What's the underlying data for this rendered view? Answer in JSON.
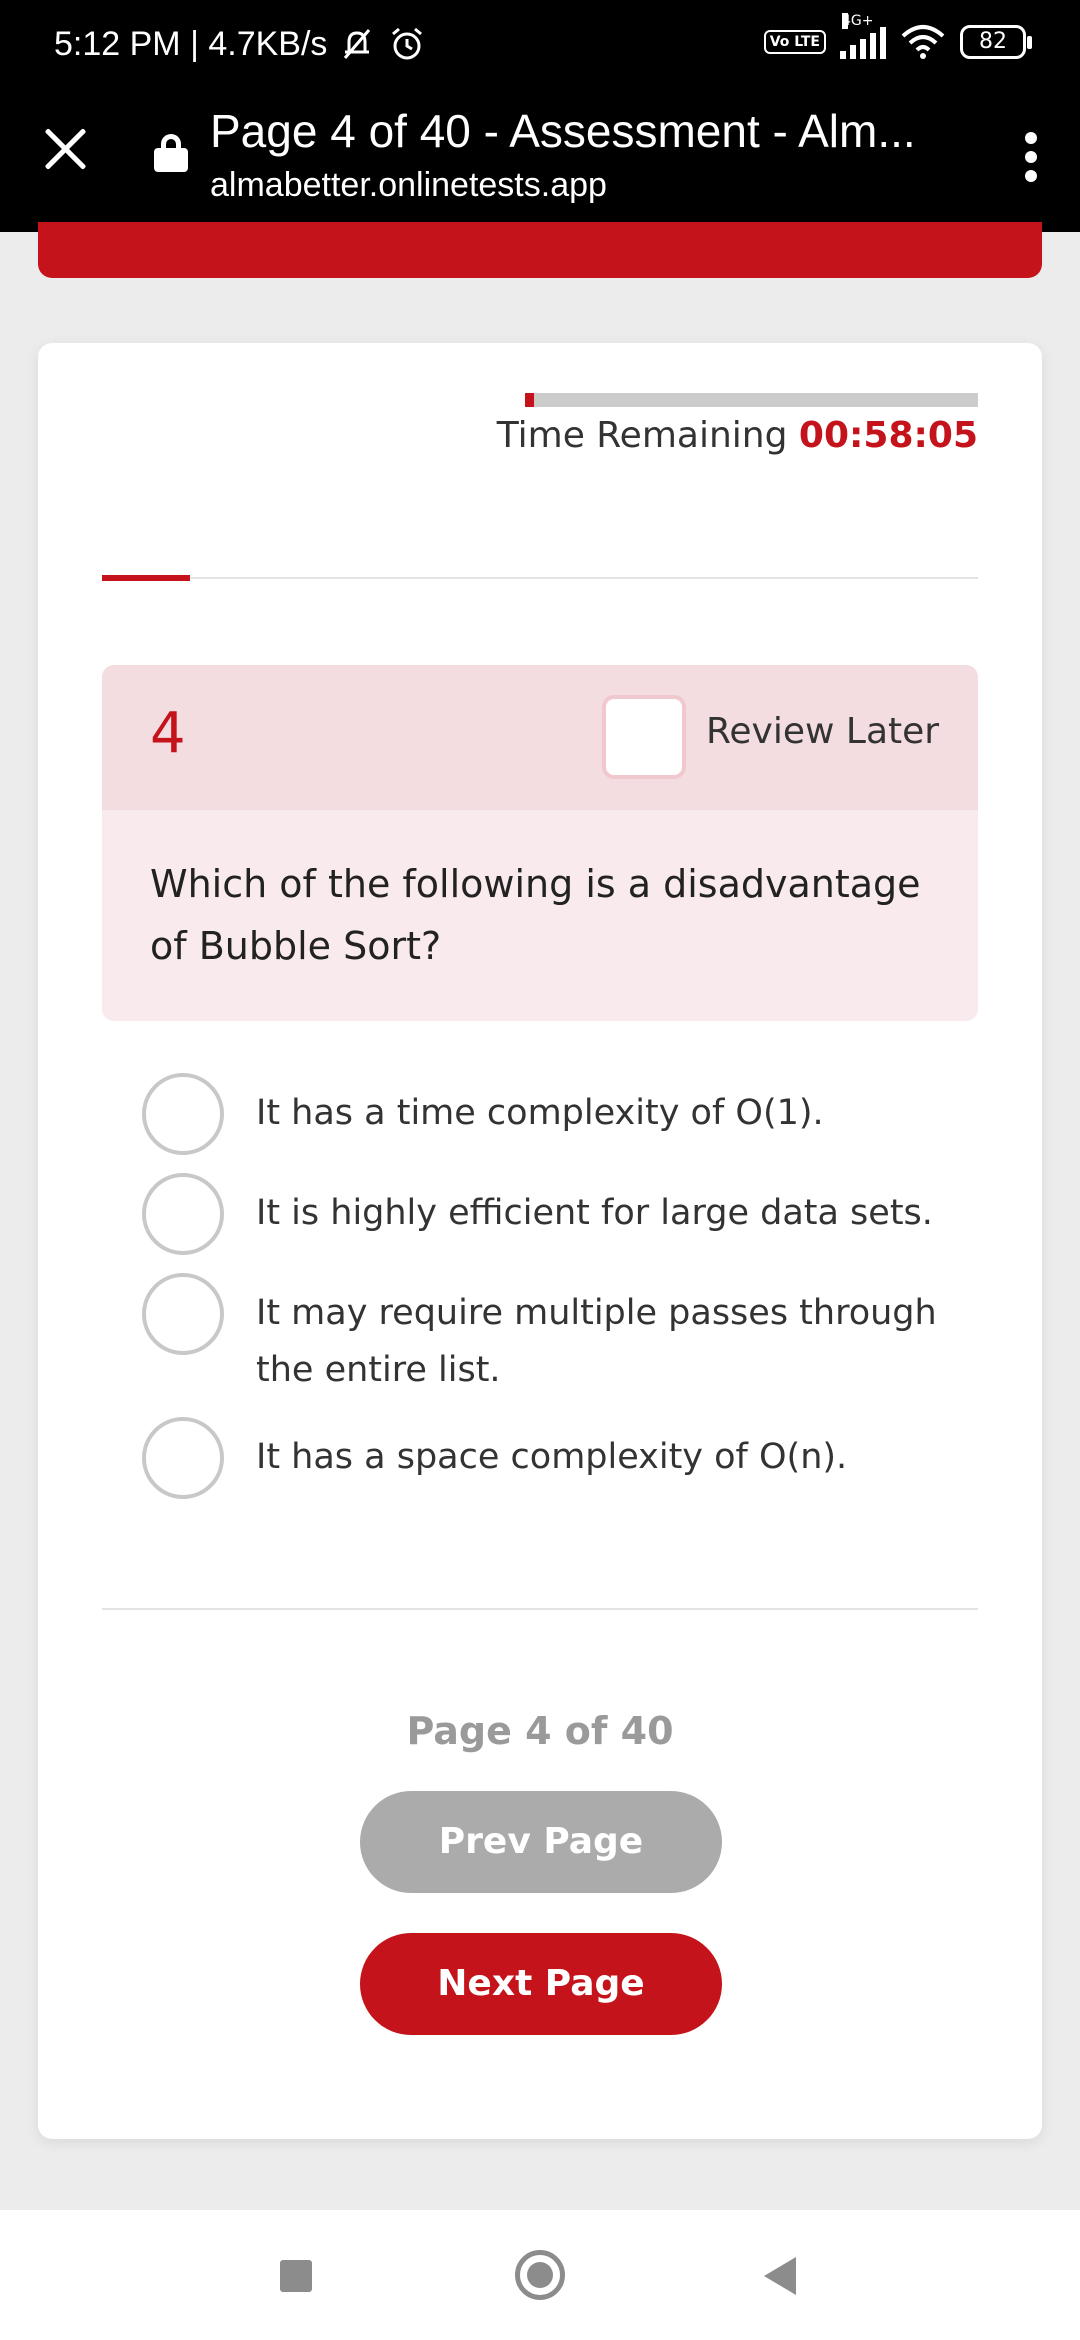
{
  "status_bar": {
    "time_speed": "5:12 PM | 4.7KB/s",
    "network": "4G+",
    "volte": "Vo LTE",
    "battery": "82"
  },
  "browser": {
    "title": "Page 4 of 40 - Assessment - Alm...",
    "url": "almabetter.onlinetests.app"
  },
  "timer": {
    "label": "Time Remaining",
    "value": "00:58:05",
    "progress_fraction": 0.02
  },
  "question_progress_fraction": 0.1,
  "question": {
    "number": "4",
    "review_label": "Review Later",
    "text": "Which of the following is a disadvantage of Bubble Sort?",
    "options": [
      "It has a time complexity of O(1).",
      "It is highly efficient for large data sets.",
      "It may require multiple passes through the entire list.",
      "It has a space complexity of O(n)."
    ]
  },
  "pagination": {
    "indicator": "Page 4 of 40",
    "prev_label": "Prev Page",
    "next_label": "Next Page"
  },
  "colors": {
    "accent": "#c4131b",
    "question_header_bg": "#f4dde0",
    "question_body_bg": "#f9ebed"
  },
  "icons": [
    "bell-off-icon",
    "alarm-icon",
    "signal-icon",
    "wifi-icon",
    "battery-icon",
    "close-icon",
    "lock-icon",
    "kebab-menu-icon",
    "nav-recents-icon",
    "nav-home-icon",
    "nav-back-icon"
  ]
}
